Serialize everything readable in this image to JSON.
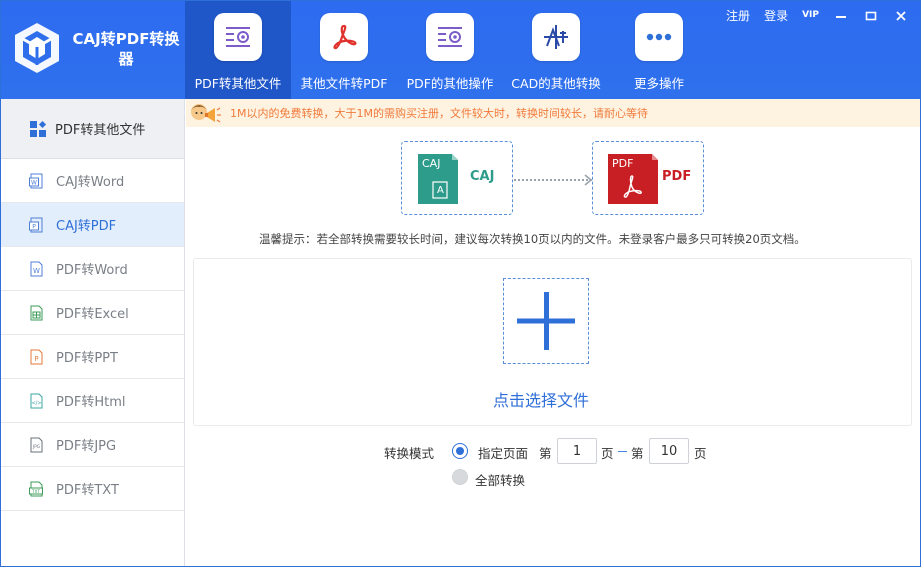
{
  "app": {
    "title": "CAJ转PDF转换器"
  },
  "top_links": {
    "register": "注册",
    "login": "登录",
    "vip": "VIP"
  },
  "nav": [
    {
      "label": "PDF转其他文件",
      "icon": "pdf-convert-gear-icon",
      "active": true
    },
    {
      "label": "其他文件转PDF",
      "icon": "acrobat-pdf-icon",
      "active": false
    },
    {
      "label": "PDF的其他操作",
      "icon": "pdf-settings-gear-icon",
      "active": false
    },
    {
      "label": "CAD的其他转换",
      "icon": "cad-drawing-icon",
      "active": false
    },
    {
      "label": "更多操作",
      "icon": "more-dots-icon",
      "active": false
    }
  ],
  "sidebar": {
    "header": "PDF转其他文件",
    "items": [
      {
        "label": "CAJ转Word",
        "icon": "word-file-icon",
        "tag": "W",
        "color": "#4f7fd6",
        "active": false
      },
      {
        "label": "CAJ转PDF",
        "icon": "pdf-file-icon",
        "tag": "P",
        "color": "#4f7fd6",
        "active": true
      },
      {
        "label": "PDF转Word",
        "icon": "word-file-icon",
        "tag": "W",
        "color": "#4f7fd6",
        "active": false
      },
      {
        "label": "PDF转Excel",
        "icon": "excel-file-icon",
        "tag": "X",
        "color": "#3d9b58",
        "active": false
      },
      {
        "label": "PDF转PPT",
        "icon": "ppt-file-icon",
        "tag": "P",
        "color": "#e07a38",
        "active": false
      },
      {
        "label": "PDF转Html",
        "icon": "html-file-icon",
        "tag": "</>",
        "color": "#3aa5a0",
        "active": false
      },
      {
        "label": "PDF转JPG",
        "icon": "jpg-file-icon",
        "tag": "JPG",
        "color": "#6a6f78",
        "active": false
      },
      {
        "label": "PDF转TXT",
        "icon": "txt-file-icon",
        "tag": "TXT",
        "color": "#3d9b58",
        "active": false
      }
    ]
  },
  "notice": "1M以内的免费转换，大于1M的需购买注册，文件较大时，转换时间较长，请耐心等待",
  "flow": {
    "source_label": "CAJ",
    "source_badge": "CAJ",
    "source_letter": "A",
    "target_label": "PDF",
    "target_badge": "PDF"
  },
  "tip": "温馨提示：若全部转换需要较长时间，建议每次转换10页以内的文件。未登录客户最多只可转换20页文档。",
  "upload": {
    "choose_label": "点击选择文件"
  },
  "mode": {
    "label": "转换模式",
    "specified_label": "指定页面",
    "from_prefix": "第",
    "from_value": "1",
    "mid_text": "页",
    "to_prefix": "第",
    "to_value": "10",
    "to_suffix": "页",
    "all_label": "全部转换",
    "selected": "specified"
  },
  "colors": {
    "header_bg": "#2f6fec",
    "nav_active_bg": "#1f56c8",
    "accent": "#2f6fd8",
    "caj_green": "#2e9c8b",
    "pdf_red": "#c81f25",
    "notice_text": "#f07a3c"
  }
}
